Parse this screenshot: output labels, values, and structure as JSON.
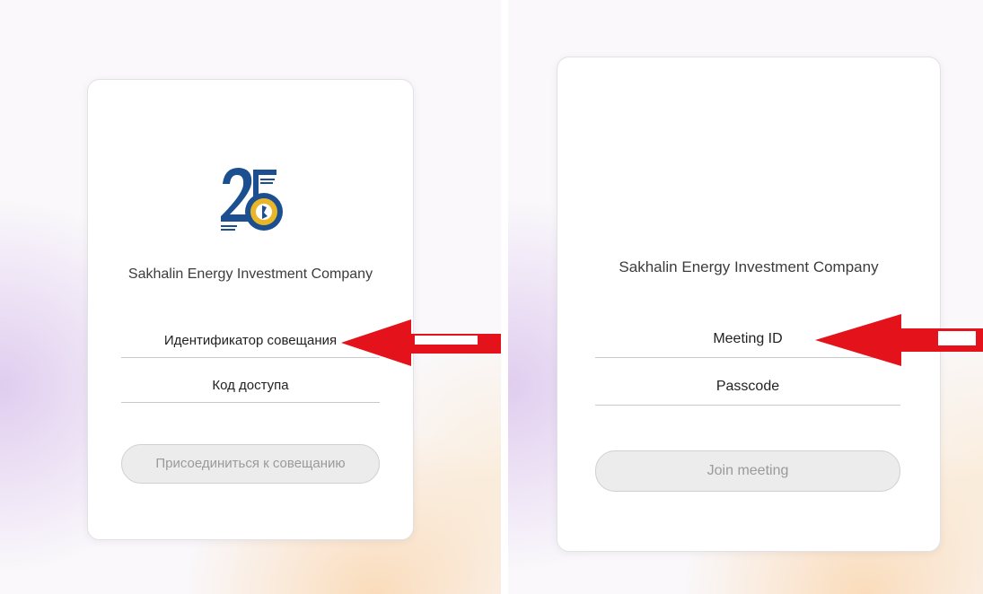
{
  "left_dialog": {
    "company_name": "Sakhalin Energy Investment Company",
    "meeting_id_placeholder": "Идентификатор совещания",
    "passcode_placeholder": "Код доступа",
    "join_button_label": "Присоединиться к совещанию",
    "logo": {
      "number": "25",
      "icon": "sakhalin-energy-25-years-logo"
    }
  },
  "right_dialog": {
    "company_name": "Sakhalin Energy Investment Company",
    "meeting_id_placeholder": "Meeting ID",
    "passcode_placeholder": "Passcode",
    "join_button_label": "Join meeting"
  },
  "colors": {
    "annotation_arrow": "#e3121b",
    "logo_blue": "#1b4f8f",
    "logo_gold": "#e8b627"
  }
}
